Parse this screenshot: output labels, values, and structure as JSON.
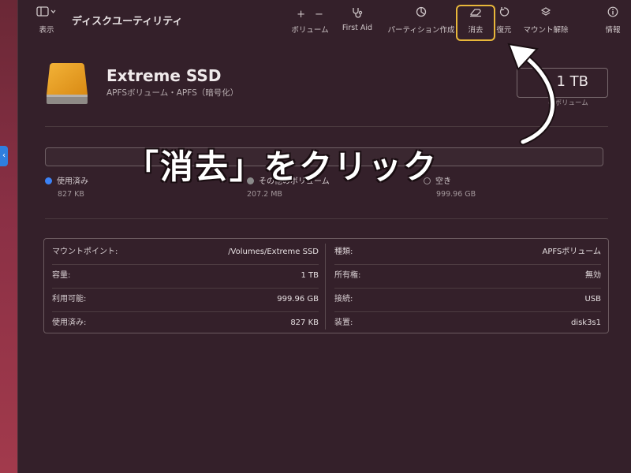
{
  "app": {
    "title": "ディスクユーティリティ"
  },
  "toolbar": {
    "view_label": "表示",
    "volume_label": "ボリューム",
    "firstaid_label": "First Aid",
    "partition_label": "パーティション作成",
    "erase_label": "消去",
    "restore_label": "復元",
    "unmount_label": "マウント解除",
    "info_label": "情報"
  },
  "icons": {
    "sidebar": "sidebar-icon",
    "plus": "plus-icon",
    "minus": "minus-icon",
    "firstaid": "stethoscope-icon",
    "partition": "pie-chart-icon",
    "erase": "eraser-icon",
    "restore": "restore-icon",
    "unmount": "eject-icon",
    "info": "info-icon",
    "disk": "external-drive-icon"
  },
  "disk": {
    "name": "Extreme SSD",
    "subtitle": "APFSボリューム・APFS（暗号化）",
    "size": "1 TB",
    "size_sub": "のボリューム"
  },
  "usage": {
    "used_label": "使用済み",
    "used_value": "827 KB",
    "used_color": "#3b82f6",
    "other_label": "その他のボリューム",
    "other_value": "207.2 MB",
    "free_label": "空き",
    "free_value": "999.96 GB"
  },
  "info": {
    "left": [
      {
        "key": "マウントポイント:",
        "value": "/Volumes/Extreme SSD"
      },
      {
        "key": "容量:",
        "value": "1 TB"
      },
      {
        "key": "利用可能:",
        "value": "999.96 GB"
      },
      {
        "key": "使用済み:",
        "value": "827 KB"
      }
    ],
    "right": [
      {
        "key": "種類:",
        "value": "APFSボリューム"
      },
      {
        "key": "所有権:",
        "value": "無効"
      },
      {
        "key": "接続:",
        "value": "USB"
      },
      {
        "key": "装置:",
        "value": "disk3s1"
      }
    ]
  },
  "annotation": {
    "callout": "「消去」をクリック",
    "highlight_color": "#e8b73a"
  }
}
